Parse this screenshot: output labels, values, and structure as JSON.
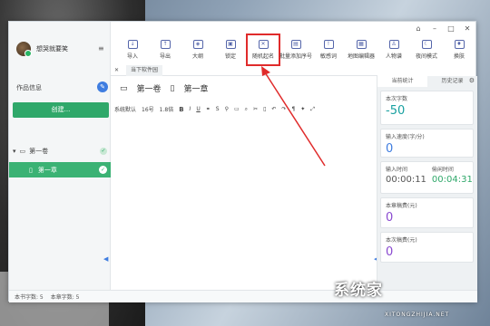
{
  "window": {
    "controls": [
      "⌂",
      "–",
      "□",
      "✕"
    ]
  },
  "user": {
    "name": "想哭就要笑",
    "menu_icon": "≡"
  },
  "sidebar": {
    "info_label": "作品信息",
    "info_icon": "✎",
    "create_label": "创建...",
    "volume": "第一卷",
    "chapter": "第一章",
    "check": "✓",
    "collapse": "◀"
  },
  "toolbar": {
    "items": [
      {
        "label": "导入",
        "icon": "↓"
      },
      {
        "label": "导出",
        "icon": "↑"
      },
      {
        "label": "大纲",
        "icon": "◈"
      },
      {
        "label": "锁定",
        "icon": "▣"
      },
      {
        "label": "随机起名",
        "icon": "✕"
      },
      {
        "label": "批量添加序号",
        "icon": "▤"
      },
      {
        "label": "敏感词",
        "icon": "!"
      },
      {
        "label": "地图编辑器",
        "icon": "▦"
      },
      {
        "label": "人物谱",
        "icon": "♙"
      },
      {
        "label": "夜间模式",
        "icon": "☾"
      },
      {
        "label": "换肤",
        "icon": "♦"
      }
    ]
  },
  "tabbar": {
    "close": "✕",
    "tab": "当下软件园"
  },
  "breadcrumb": {
    "volume": "第一卷",
    "chapter": "第一章"
  },
  "format": {
    "font": "系统默认",
    "size": "16号",
    "spacing": "1.8倍",
    "bold": "B",
    "italic": "I",
    "underline": "U"
  },
  "stats": {
    "tab_current": "当前统计",
    "tab_history": "历史记录",
    "gear": "⚙",
    "word_count_label": "本次字数",
    "word_count": "-50",
    "speed_label": "输入速度(字/分)",
    "speed": "0",
    "input_time_label": "输入时间",
    "input_time": "00:00:11",
    "idle_time_label": "偷闲时间",
    "idle_time": "00:04:31",
    "chapter_fee_label": "本章稿费(元)",
    "chapter_fee": "0",
    "session_fee_label": "本次稿费(元)",
    "session_fee": "0"
  },
  "statusbar": {
    "book_words": "本书字数: 5",
    "chapter_words": "本章字数: 5"
  },
  "colors": {
    "accent": "#2fa86a",
    "highlight": "#e02b2b",
    "blue": "#3f7de0"
  },
  "watermark": {
    "text": "系统家",
    "url": "XITONGZHIJIA.NET"
  }
}
